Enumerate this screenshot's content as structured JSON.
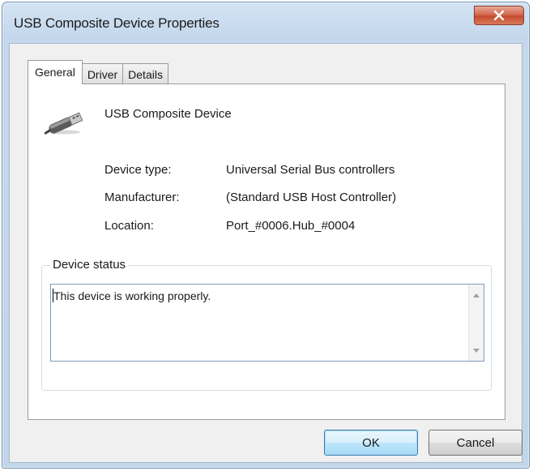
{
  "window": {
    "title": "USB Composite Device Properties",
    "close_icon": "close-icon"
  },
  "tabs": [
    {
      "label": "General",
      "active": true
    },
    {
      "label": "Driver",
      "active": false
    },
    {
      "label": "Details",
      "active": false
    }
  ],
  "device": {
    "icon": "usb-plug-icon",
    "name": "USB Composite Device"
  },
  "info": {
    "device_type_label": "Device type:",
    "device_type_value": "Universal Serial Bus controllers",
    "manufacturer_label": "Manufacturer:",
    "manufacturer_value": "(Standard USB Host Controller)",
    "location_label": "Location:",
    "location_value": "Port_#0006.Hub_#0004"
  },
  "status": {
    "group_label": "Device status",
    "text": "This device is working properly."
  },
  "buttons": {
    "ok_label": "OK",
    "cancel_label": "Cancel"
  },
  "colors": {
    "close_button": "#c44a30",
    "default_button_border": "#3c7fb1",
    "frame": "#c2d6eb"
  }
}
